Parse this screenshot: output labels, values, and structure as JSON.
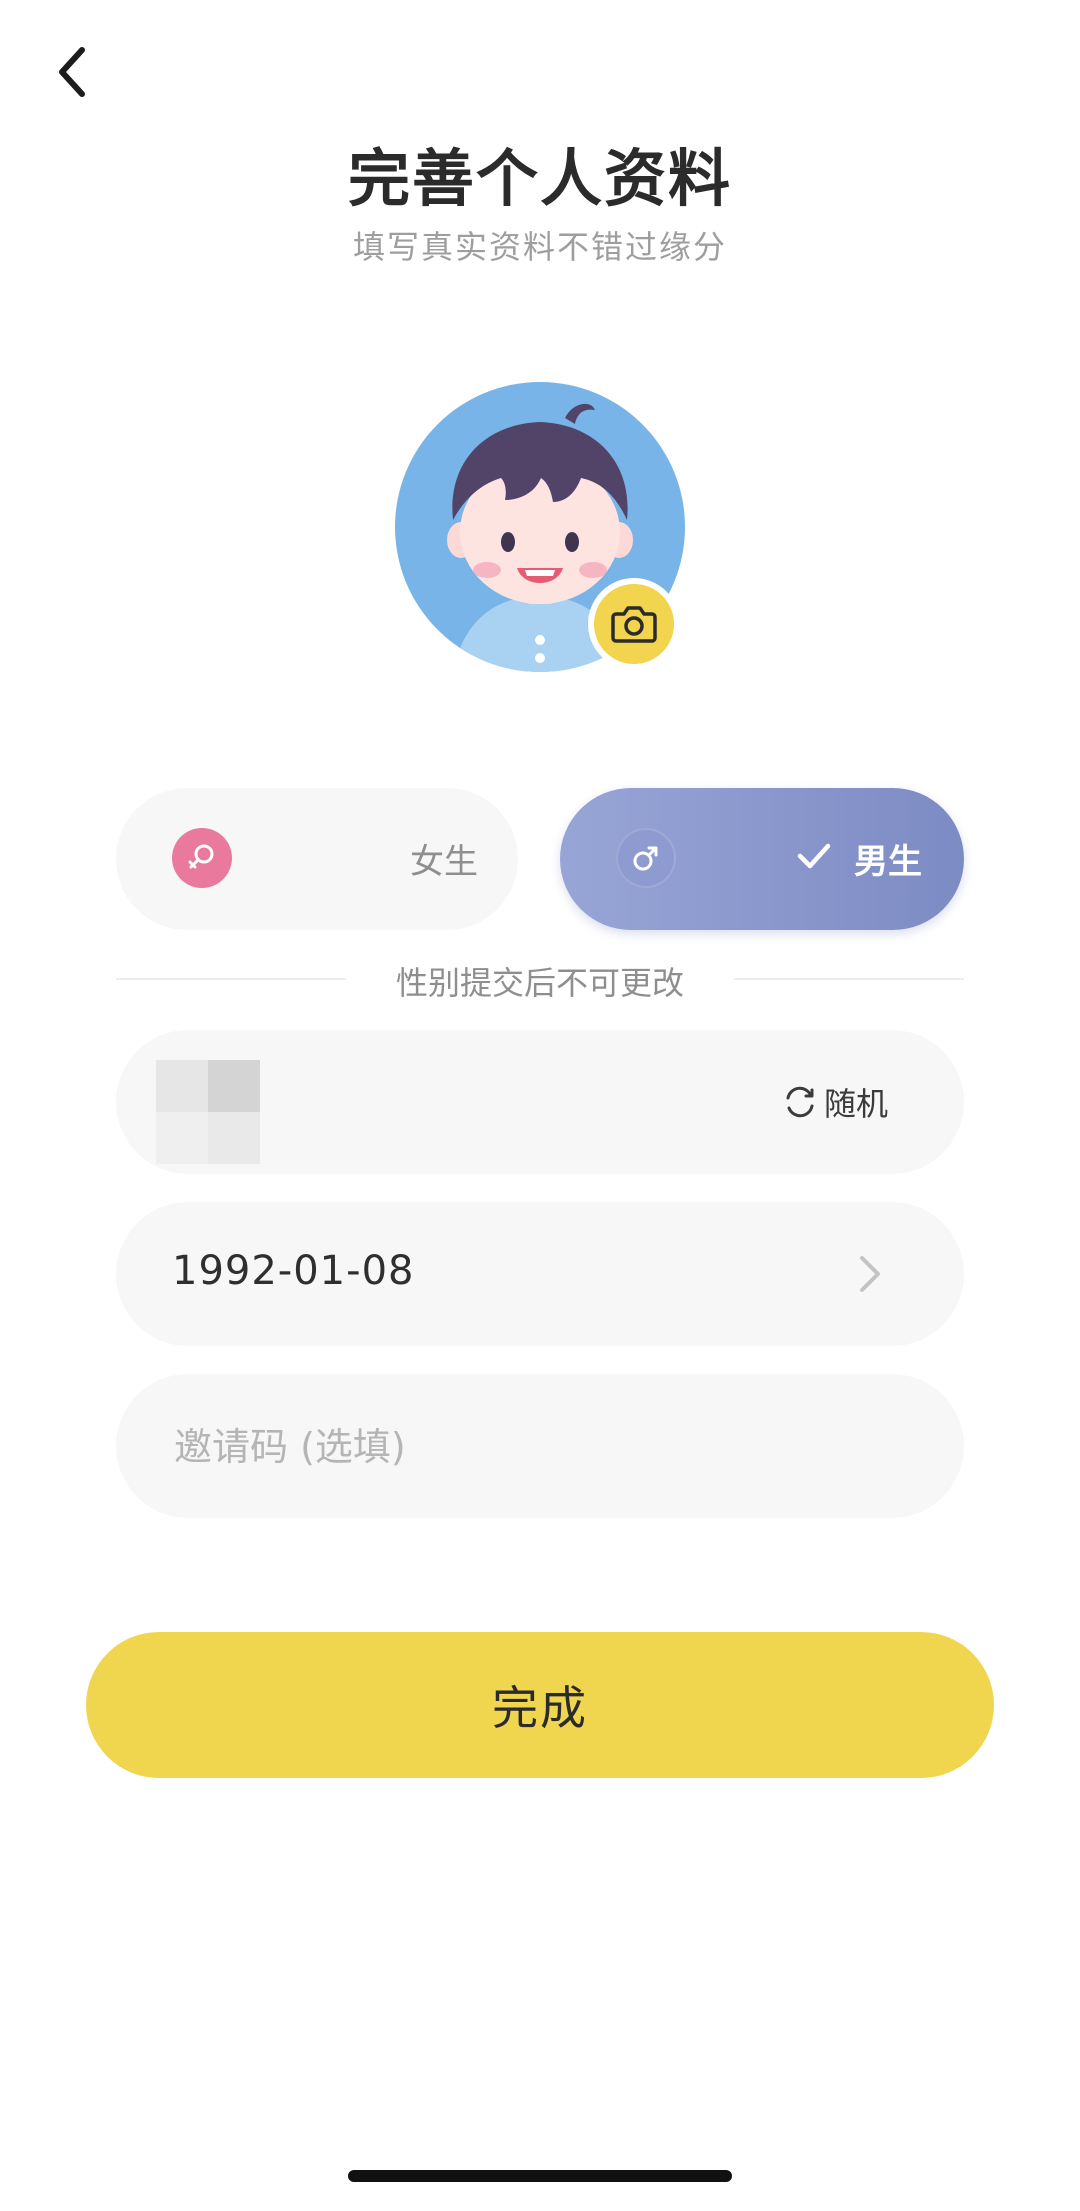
{
  "header": {
    "back_icon": "chevron-left-icon",
    "title": "完善个人资料",
    "subtitle": "填写真实资料不错过缘分"
  },
  "avatar": {
    "icon": "boy-avatar",
    "camera_icon": "camera-icon"
  },
  "gender": {
    "female": {
      "label": "女生",
      "icon": "female-symbol-icon",
      "selected": false
    },
    "male": {
      "label": "男生",
      "icon": "male-symbol-icon",
      "selected": true
    },
    "notice": "性别提交后不可更改"
  },
  "nickname": {
    "random_label": "随机",
    "random_icon": "refresh-icon"
  },
  "birthday": {
    "value": "1992-01-08",
    "chevron_icon": "chevron-right-icon"
  },
  "invite_code": {
    "value": "",
    "placeholder": "邀请码 (选填)"
  },
  "actions": {
    "done_label": "完成"
  },
  "colors": {
    "accent_yellow": "#f0d54f",
    "male_selected": "#7d8bc4",
    "female_icon": "#e97a9e",
    "avatar_bg": "#78b4e8"
  }
}
